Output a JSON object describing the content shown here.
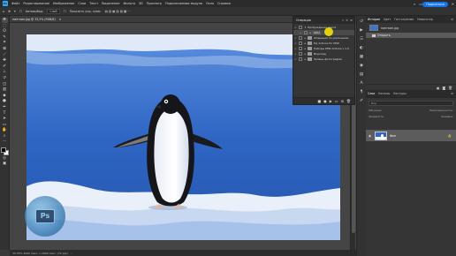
{
  "menubar": {
    "items": [
      "Файл",
      "Редактирование",
      "Изображение",
      "Слои",
      "Текст",
      "Выделение",
      "Фильтр",
      "3D",
      "Просмотр",
      "Подключаемые модули",
      "Окно",
      "Справка"
    ]
  },
  "options": {
    "autoselect_label": "Автовыбор:",
    "autoselect_value": "Слой",
    "show_controls": "Показать упр. элем."
  },
  "share_label": "Поделиться",
  "document": {
    "tab_title": "пингвин.jpg @ 33,3% (RGB/8)",
    "status": "33,33%    3000 пикс. x 2000 пикс. (72 ppi)"
  },
  "actions_panel": {
    "title": "Операции",
    "items": [
      {
        "label": "Пробуждение цвета",
        "checked": true,
        "type": "action",
        "expanded": true
      },
      {
        "label": "APAJ",
        "checked": true,
        "type": "step",
        "selected": true
      },
      {
        "label": "Операции по умолчанию",
        "checked": true,
        "type": "set",
        "expanded": false
      },
      {
        "label": "My Actions for PPW",
        "checked": true,
        "type": "set",
        "expanded": false
      },
      {
        "label": "Наборы PPW Actions v 1.0",
        "checked": true,
        "type": "set",
        "expanded": false
      },
      {
        "label": "Водопад",
        "checked": true,
        "type": "set",
        "expanded": false
      },
      {
        "label": "Зелень фотографии",
        "checked": true,
        "type": "set",
        "expanded": false
      }
    ],
    "footer_icons": [
      "stop-icon",
      "record-icon",
      "play-icon",
      "folder-icon",
      "new-action-icon",
      "trash-icon"
    ]
  },
  "history_panel": {
    "tabs": [
      "История",
      "Цвет",
      "Гистограмма",
      "Навигатор"
    ],
    "snapshot_label": "пингвин.jpg",
    "states": [
      "Открыть"
    ]
  },
  "layers_panel": {
    "tabs": [
      "Слои",
      "Каналы",
      "Контуры"
    ],
    "search_placeholder": "Вид",
    "blend_mode": "Обычные",
    "opacity_label": "Непрозрачность:",
    "lock_label": "Закрепить:",
    "fill_label": "Заливка:",
    "layer_name": "Фон"
  }
}
